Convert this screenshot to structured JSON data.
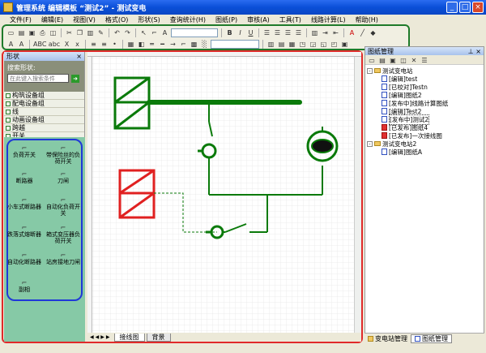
{
  "window": {
    "title": "管理系统 编辑模板 “测试2” - 测试变电",
    "controls": [
      "_",
      "□",
      "×"
    ]
  },
  "menu": [
    "文件(F)",
    "编辑(E)",
    "视图(V)",
    "格式(O)",
    "形状(S)",
    "查询统计(H)",
    "图纸(P)",
    "审核(A)",
    "工具(T)",
    "线路计算(L)",
    "帮助(H)"
  ],
  "toolbar": {
    "bold": "B",
    "italic": "I",
    "underline": "U",
    "font_size_a": "A",
    "text_tools": [
      "A",
      "ABC",
      "abc",
      "X",
      "x"
    ]
  },
  "left_panel": {
    "title": "形状",
    "search_label": "搜索形状:",
    "search_placeholder": "在此键入搜索条件",
    "groups": [
      "构筑设备组",
      "配电设备组",
      "线",
      "动画设备组",
      "跨越",
      "开关"
    ],
    "shapes": [
      "负荷开关",
      "带保险丝的负荷开关",
      "断路器",
      "刀闸",
      "小车式断路器",
      "自动化负荷开关",
      "跌落式熔断器",
      "箱式变压器负荷开关",
      "自动化断路器",
      "站房接地刀闸",
      "副相"
    ]
  },
  "canvas": {
    "sheet_tabs": [
      "接线图",
      "背景"
    ]
  },
  "right_panel": {
    "title": "图纸管理",
    "tree": [
      {
        "label": "测试变电站",
        "level": 0,
        "type": "folder",
        "expanded": true
      },
      {
        "label": "[编辑]test",
        "level": 1,
        "type": "doc"
      },
      {
        "label": "[已校对]Testn",
        "level": 1,
        "type": "doc"
      },
      {
        "label": "[编辑]图纸2",
        "level": 1,
        "type": "doc"
      },
      {
        "label": "[发布中]线路计算图纸",
        "level": 1,
        "type": "doc"
      },
      {
        "label": "[编辑]Test2",
        "level": 1,
        "type": "doc"
      },
      {
        "label": "[发布中]测试2",
        "level": 1,
        "type": "doc",
        "selected": true
      },
      {
        "label": "[已发布]图纸4",
        "level": 1,
        "type": "doc-red"
      },
      {
        "label": "[已发布]一次接线图",
        "level": 1,
        "type": "doc-red"
      },
      {
        "label": "测试变电站2",
        "level": 0,
        "type": "folder",
        "expanded": true
      },
      {
        "label": "[编辑]图纸A",
        "level": 1,
        "type": "doc"
      }
    ],
    "tabs": [
      "变电站管理",
      "图纸管理"
    ]
  }
}
